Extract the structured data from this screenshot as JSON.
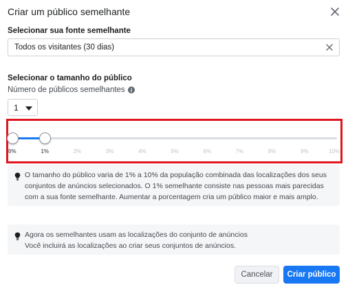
{
  "dialog": {
    "title": "Criar um público semelhante"
  },
  "source": {
    "label": "Selecionar sua fonte semelhante",
    "value": "Todos os visitantes (30 dias)"
  },
  "audience_size": {
    "label": "Selecionar o tamanho do público",
    "count_label": "Número de públicos semelhantes",
    "count_value": "1",
    "range_start_percent": 0,
    "range_end_percent": 1,
    "ticks": [
      "0%",
      "1%",
      "2%",
      "3%",
      "4%",
      "5%",
      "6%",
      "7%",
      "8%",
      "9%",
      "10%"
    ]
  },
  "info_boxes": [
    {
      "lines": [
        "O tamanho do público varia de 1% a 10% da população combinada das localizações dos seus",
        "conjuntos de anúncios selecionados. O 1% semelhante consiste nas pessoas mais parecidas",
        "com a sua fonte semelhante. Aumentar a porcentagem cria um público maior e mais amplo."
      ]
    },
    {
      "lines": [
        "Agora os semelhantes usam as localizações do conjunto de anúncios",
        "Você incluirá as localizações ao criar seus conjuntos de anúncios."
      ]
    }
  ],
  "footer": {
    "cancel_label": "Cancelar",
    "create_label": "Criar público"
  },
  "colors": {
    "accent": "#1877f2",
    "highlight_frame": "#e0141e"
  }
}
